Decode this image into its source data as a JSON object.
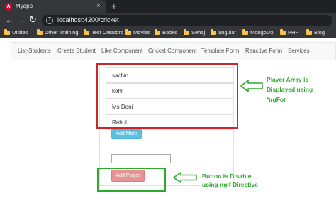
{
  "browser": {
    "tab_title": "Myapp",
    "tab_close": "×",
    "new_tab": "+",
    "url": "localhost:4200/cricket",
    "icons": {
      "back": "arrow-left",
      "forward": "arrow-right",
      "reload": "reload",
      "info": "info-circle"
    }
  },
  "bookmarks": [
    "Utilites",
    "Other Training",
    "Test Creators",
    "Movies",
    "Books",
    "Sehaj",
    "angular",
    "MongoDb",
    "PHP",
    "Blog"
  ],
  "navbar": {
    "links": [
      "List-Students",
      "Create Student",
      "Like Component",
      "Cricket Component",
      "Template Form",
      "Reactive Form",
      "Services"
    ]
  },
  "players": [
    "sachin",
    "kohli",
    "Ms Doni",
    "Rahul"
  ],
  "add_more_label": "Add More",
  "player_input_value": "",
  "add_player_label": "Add Player",
  "annotations": {
    "list_note": [
      "Player Array is",
      "Displayed using",
      "*ngFor"
    ],
    "button_note": [
      "Button is Disable",
      "using ngIf Directive"
    ]
  },
  "colors": {
    "highlight_red": "#c8282d",
    "highlight_green": "#2fa82f",
    "info_button": "#5bc0de",
    "disabled_danger_button": "#e59493"
  }
}
